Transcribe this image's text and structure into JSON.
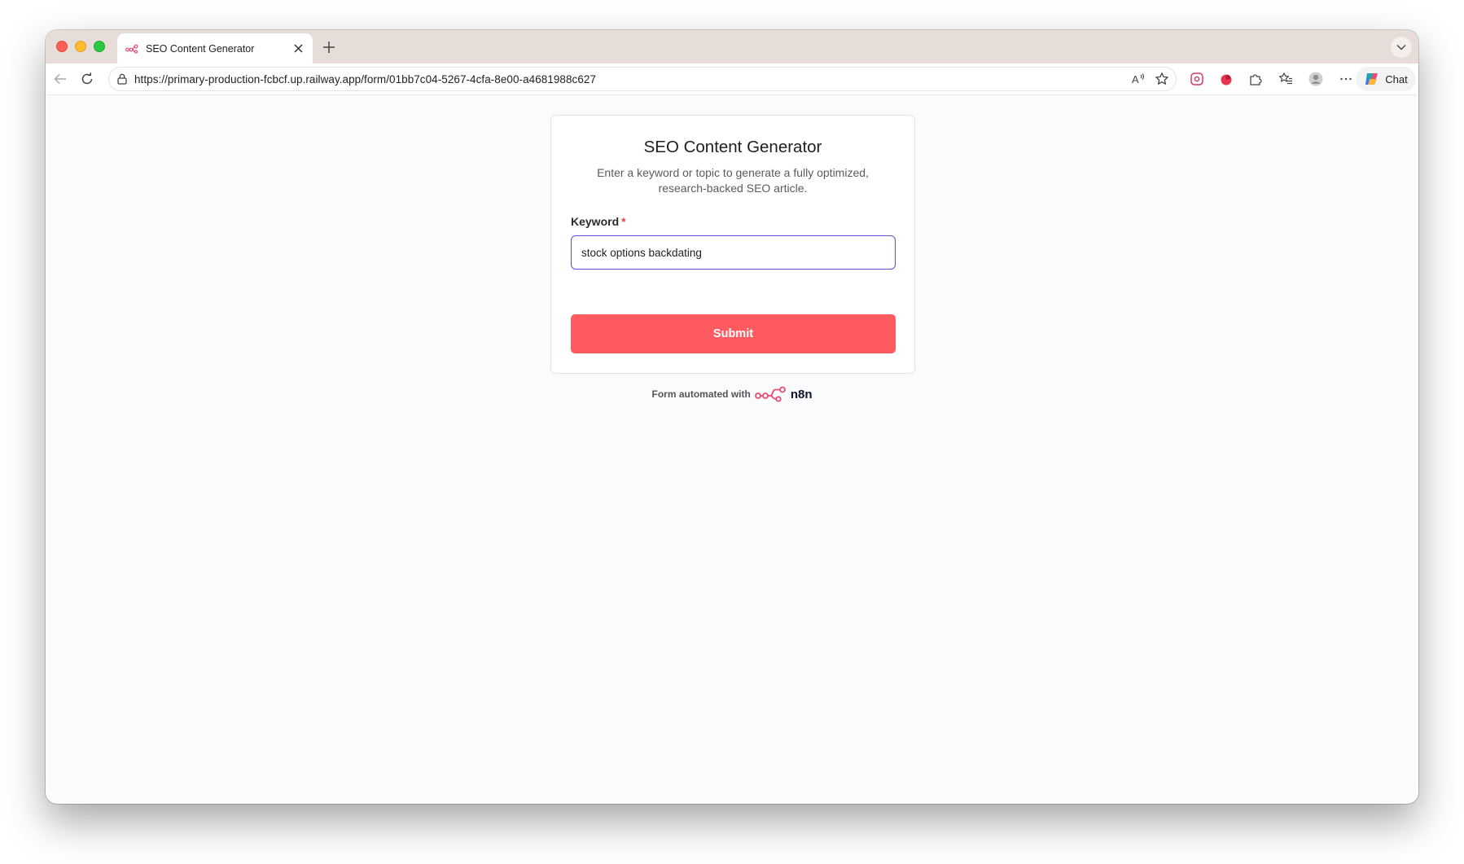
{
  "browser": {
    "tab_title": "SEO Content Generator",
    "url": "https://primary-production-fcbcf.up.railway.app/form/01bb7c04-5267-4cfa-8e00-a4681988c627",
    "chat_label": "Chat",
    "accent_colors": {
      "tab_strip": "#e6ddd8",
      "brand_pink": "#ea4b71"
    }
  },
  "form": {
    "title": "SEO Content Generator",
    "description": "Enter a keyword or topic to generate a fully optimized, research-backed SEO article.",
    "field": {
      "label": "Keyword",
      "required_marker": "*",
      "value": "stock options backdating"
    },
    "submit_label": "Submit",
    "submit_color": "#ff5a5f",
    "input_border_color": "#5f4fd8"
  },
  "footer": {
    "text": "Form automated with",
    "brand": "n8n"
  }
}
